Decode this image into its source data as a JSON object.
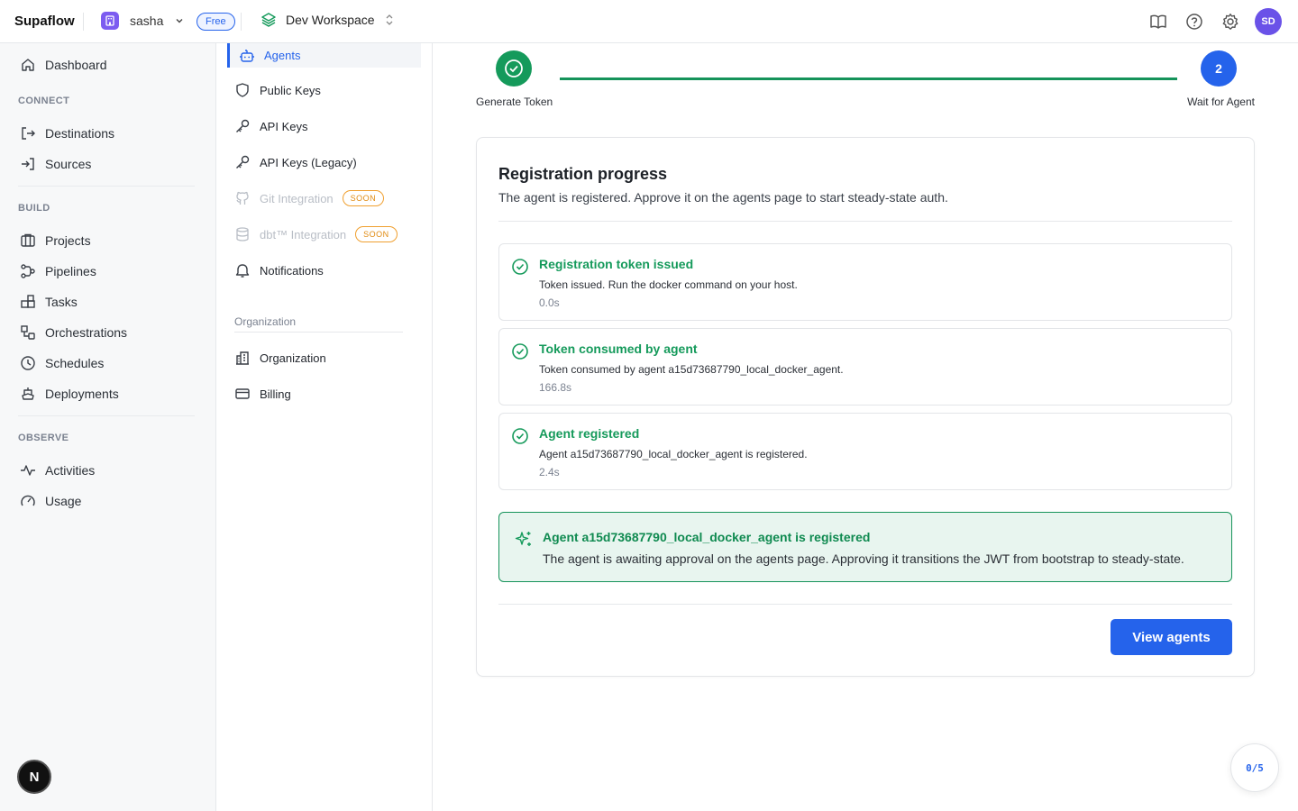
{
  "brand": "Supaflow",
  "org": {
    "name": "sasha",
    "plan": "Free"
  },
  "workspace": {
    "name": "Dev Workspace"
  },
  "user": {
    "initials": "SD"
  },
  "sidebar": {
    "dashboard": "Dashboard",
    "sections": [
      {
        "label": "CONNECT",
        "items": [
          "Destinations",
          "Sources"
        ]
      },
      {
        "label": "BUILD",
        "items": [
          "Projects",
          "Pipelines",
          "Tasks",
          "Orchestrations",
          "Schedules",
          "Deployments"
        ]
      },
      {
        "label": "OBSERVE",
        "items": [
          "Activities",
          "Usage"
        ]
      }
    ],
    "dev_badge": "N"
  },
  "settings_nav": {
    "items": [
      "Agents",
      "Public Keys",
      "API Keys",
      "API Keys (Legacy)",
      "Git Integration",
      "dbt™ Integration",
      "Notifications"
    ],
    "soon_label": "SOON",
    "org_section": "Organization",
    "org_items": [
      "Organization",
      "Billing"
    ],
    "active": "Agents"
  },
  "stepper": {
    "steps": [
      {
        "label": "Generate Token",
        "status": "complete"
      },
      {
        "number": "2",
        "label": "Wait for Agent",
        "status": "current"
      }
    ]
  },
  "registration": {
    "title": "Registration progress",
    "subtitle": "The agent is registered. Approve it on the agents page to start steady-state auth.",
    "events": [
      {
        "title": "Registration token issued",
        "description": "Token issued. Run the docker command on your host.",
        "time": "0.0s"
      },
      {
        "title": "Token consumed by agent",
        "description": "Token consumed by agent a15d73687790_local_docker_agent.",
        "time": "166.8s"
      },
      {
        "title": "Agent registered",
        "description": "Agent a15d73687790_local_docker_agent is registered.",
        "time": "2.4s"
      }
    ],
    "success": {
      "title": "Agent a15d73687790_local_docker_agent is registered",
      "message": "The agent is awaiting approval on the agents page. Approving it transitions the JWT from bootstrap to steady-state."
    },
    "action_label": "View agents"
  },
  "onboarding_progress": "0/5",
  "colors": {
    "accent": "#2563eb",
    "success": "#159a5b",
    "org_badge": "#7c5cf0",
    "soon": "#f0a030"
  }
}
